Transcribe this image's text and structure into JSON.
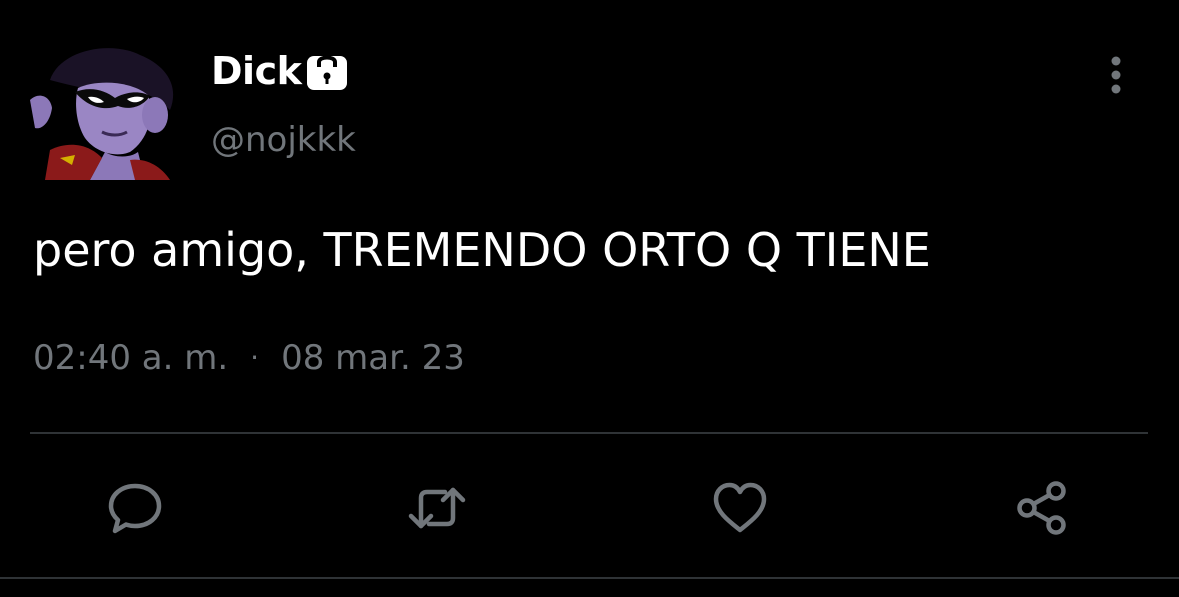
{
  "user": {
    "display_name": "Dick",
    "handle": "@nojkkk",
    "protected_icon": "lock-icon",
    "avatar_icon": "avatar-image"
  },
  "tweet": {
    "text": "pero amigo, TREMENDO ORTO Q TIENE",
    "time": "02:40 a. m.",
    "separator": "·",
    "date": "08 mar. 23"
  },
  "actions": {
    "reply_icon": "comment-icon",
    "retweet_icon": "retweet-icon",
    "like_icon": "heart-icon",
    "share_icon": "share-icon",
    "more_icon": "vertical-dots-icon"
  },
  "colors": {
    "background": "#000000",
    "primary_text": "#ffffff",
    "secondary_text": "#71767b",
    "divider": "#2f3336",
    "icon": "#71767b"
  }
}
